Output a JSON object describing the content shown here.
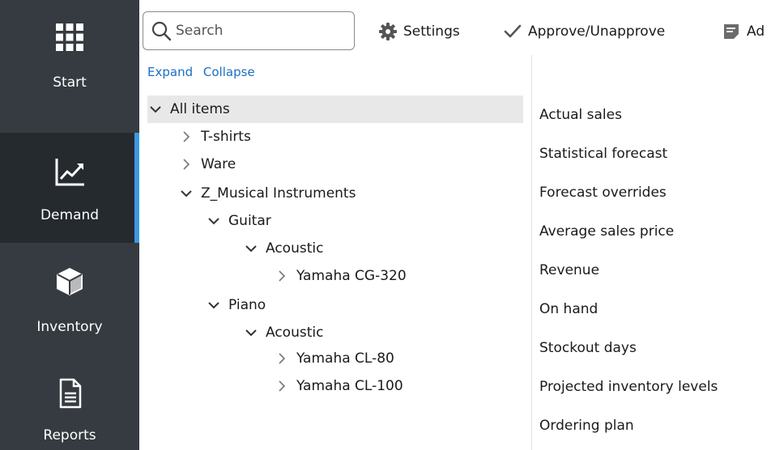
{
  "nav": {
    "items": [
      {
        "label": "Start",
        "icon": "grid-icon",
        "active": false
      },
      {
        "label": "Demand",
        "icon": "trend-chart-icon",
        "active": true
      },
      {
        "label": "Inventory",
        "icon": "box-icon",
        "active": false
      },
      {
        "label": "Reports",
        "icon": "report-document-icon",
        "active": false
      }
    ],
    "accent_color": "#3c98e1"
  },
  "toolbar": {
    "search_placeholder": "Search",
    "settings_label": "Settings",
    "approve_label": "Approve/Unapprove",
    "truncated_label": "Ad"
  },
  "tree": {
    "expand_label": "Expand",
    "collapse_label": "Collapse",
    "nodes": [
      {
        "label": "All items",
        "state": "expanded",
        "level": 0,
        "selected": true
      },
      {
        "label": "T-shirts",
        "state": "collapsed",
        "level": 1
      },
      {
        "label": "Ware",
        "state": "collapsed",
        "level": 1
      },
      {
        "label": "Z_Musical Instruments",
        "state": "expanded",
        "level": 1
      },
      {
        "label": "Guitar",
        "state": "expanded",
        "level": 2
      },
      {
        "label": "Acoustic",
        "state": "expanded",
        "level": 3
      },
      {
        "label": "Yamaha CG-320",
        "state": "collapsed",
        "level": 4
      },
      {
        "label": "Piano",
        "state": "expanded",
        "level": 2
      },
      {
        "label": "Acoustic",
        "state": "expanded",
        "level": 3
      },
      {
        "label": "Yamaha CL-80",
        "state": "collapsed",
        "level": 4
      },
      {
        "label": "Yamaha CL-100",
        "state": "collapsed",
        "level": 4
      }
    ]
  },
  "measures": [
    "Actual sales",
    "Statistical forecast",
    "Forecast overrides",
    "Average sales price",
    "Revenue",
    "On hand",
    "Stockout days",
    "Projected inventory levels",
    "Ordering plan"
  ]
}
